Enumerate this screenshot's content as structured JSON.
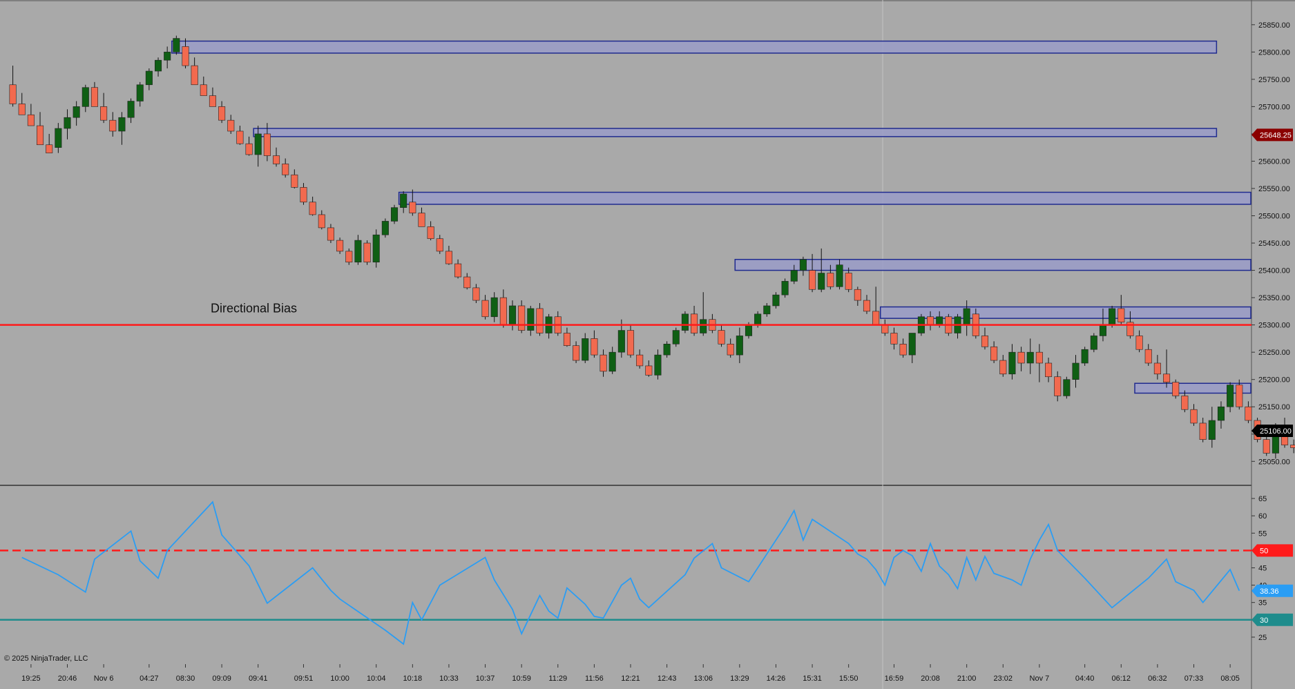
{
  "copyright": "© 2025 NinjaTrader, LLC",
  "colors": {
    "background": "#a9a9a9",
    "up_candle": "#0f5f14",
    "down_candle": "#f26a4f",
    "zone_fill": "#9a9cc8",
    "zone_stroke": "#1f2a8f",
    "bias_line": "#ff1a1a",
    "rsi_line": "#2a9df4",
    "rsi_30_line": "#1e8c8c",
    "rsi_50_line": "#ff1a1a",
    "last_price_tag": "#000000",
    "marker_price_tag": "#8b0000"
  },
  "chart_data": [
    {
      "type": "candlestick",
      "title": "",
      "annotation": "Directional Bias",
      "bias_level": 25300,
      "ylim": [
        25020,
        25870
      ],
      "y_ticks": [
        "25850.00",
        "25800.00",
        "25750.00",
        "25700.00",
        "25650.00",
        "25600.00",
        "25550.00",
        "25500.00",
        "25450.00",
        "25400.00",
        "25350.00",
        "25300.00",
        "25250.00",
        "25200.00",
        "25150.00",
        "25100.00",
        "25050.00"
      ],
      "y_tick_values": [
        25850,
        25800,
        25750,
        25700,
        25650,
        25600,
        25550,
        25500,
        25450,
        25400,
        25350,
        25300,
        25250,
        25200,
        25150,
        25100,
        25050
      ],
      "x_tick_labels": [
        "19:25",
        "20:46",
        "Nov 6",
        "04:27",
        "08:30",
        "09:09",
        "09:41",
        "09:51",
        "10:00",
        "10:04",
        "10:18",
        "10:33",
        "10:37",
        "10:59",
        "11:29",
        "11:56",
        "12:21",
        "12:43",
        "13:06",
        "13:29",
        "14:26",
        "15:31",
        "15:50",
        "16:59",
        "20:08",
        "21:00",
        "23:02",
        "Nov 7",
        "04:40",
        "06:12",
        "06:32",
        "07:33",
        "08:05"
      ],
      "x_tick_bar_index": [
        2,
        6,
        10,
        15,
        19,
        23,
        27,
        32,
        36,
        40,
        44,
        48,
        52,
        56,
        60,
        64,
        68,
        72,
        76,
        80,
        84,
        88,
        92,
        97,
        101,
        105,
        109,
        113,
        118,
        122,
        126,
        130,
        134
      ],
      "bar_count": 137,
      "marked_price": "25648.25",
      "last_price": "25106.00",
      "candles": [
        [
          25740,
          25775,
          25700,
          25705
        ],
        [
          25705,
          25725,
          25685,
          25685
        ],
        [
          25685,
          25705,
          25665,
          25665
        ],
        [
          25665,
          25690,
          25630,
          25630
        ],
        [
          25630,
          25650,
          25615,
          25615
        ],
        [
          25625,
          25670,
          25615,
          25660
        ],
        [
          25660,
          25695,
          25640,
          25680
        ],
        [
          25680,
          25710,
          25665,
          25700
        ],
        [
          25700,
          25740,
          25690,
          25735
        ],
        [
          25735,
          25745,
          25700,
          25700
        ],
        [
          25700,
          25725,
          25670,
          25675
        ],
        [
          25675,
          25690,
          25645,
          25655
        ],
        [
          25655,
          25690,
          25630,
          25680
        ],
        [
          25680,
          25715,
          25670,
          25710
        ],
        [
          25710,
          25745,
          25700,
          25740
        ],
        [
          25740,
          25770,
          25730,
          25765
        ],
        [
          25765,
          25790,
          25755,
          25785
        ],
        [
          25785,
          25810,
          25770,
          25800
        ],
        [
          25800,
          25830,
          25795,
          25825
        ],
        [
          25810,
          25825,
          25770,
          25775
        ],
        [
          25775,
          25790,
          25740,
          25740
        ],
        [
          25740,
          25755,
          25720,
          25720
        ],
        [
          25720,
          25735,
          25700,
          25700
        ],
        [
          25700,
          25710,
          25670,
          25675
        ],
        [
          25675,
          25685,
          25650,
          25655
        ],
        [
          25655,
          25665,
          25630,
          25632
        ],
        [
          25632,
          25645,
          25610,
          25612
        ],
        [
          25612,
          25665,
          25590,
          25650
        ],
        [
          25650,
          25670,
          25600,
          25610
        ],
        [
          25610,
          25625,
          25590,
          25595
        ],
        [
          25595,
          25605,
          25570,
          25575
        ],
        [
          25575,
          25585,
          25550,
          25552
        ],
        [
          25552,
          25560,
          25520,
          25525
        ],
        [
          25525,
          25535,
          25500,
          25502
        ],
        [
          25502,
          25510,
          25475,
          25478
        ],
        [
          25478,
          25485,
          25450,
          25455
        ],
        [
          25455,
          25460,
          25430,
          25435
        ],
        [
          25435,
          25440,
          25410,
          25415
        ],
        [
          25415,
          25465,
          25410,
          25455
        ],
        [
          25450,
          25455,
          25410,
          25415
        ],
        [
          25415,
          25475,
          25405,
          25465
        ],
        [
          25465,
          25495,
          25460,
          25490
        ],
        [
          25490,
          25520,
          25485,
          25515
        ],
        [
          25515,
          25545,
          25505,
          25540
        ],
        [
          25525,
          25548,
          25500,
          25505
        ],
        [
          25505,
          25515,
          25480,
          25480
        ],
        [
          25480,
          25490,
          25455,
          25458
        ],
        [
          25458,
          25465,
          25430,
          25435
        ],
        [
          25435,
          25445,
          25410,
          25412
        ],
        [
          25412,
          25420,
          25385,
          25388
        ],
        [
          25388,
          25395,
          25365,
          25368
        ],
        [
          25368,
          25375,
          25340,
          25345
        ],
        [
          25345,
          25355,
          25310,
          25315
        ],
        [
          25315,
          25360,
          25305,
          25350
        ],
        [
          25350,
          25365,
          25295,
          25300
        ],
        [
          25300,
          25345,
          25290,
          25335
        ],
        [
          25335,
          25345,
          25285,
          25290
        ],
        [
          25290,
          25335,
          25280,
          25330
        ],
        [
          25330,
          25340,
          25280,
          25285
        ],
        [
          25285,
          25320,
          25275,
          25315
        ],
        [
          25315,
          25325,
          25280,
          25285
        ],
        [
          25285,
          25295,
          25260,
          25262
        ],
        [
          25262,
          25270,
          25230,
          25235
        ],
        [
          25235,
          25285,
          25230,
          25275
        ],
        [
          25275,
          25290,
          25240,
          25245
        ],
        [
          25245,
          25255,
          25205,
          25215
        ],
        [
          25215,
          25260,
          25210,
          25250
        ],
        [
          25250,
          25310,
          25240,
          25290
        ],
        [
          25290,
          25300,
          25240,
          25245
        ],
        [
          25245,
          25255,
          25220,
          25225
        ],
        [
          25225,
          25235,
          25205,
          25208
        ],
        [
          25208,
          25255,
          25200,
          25245
        ],
        [
          25245,
          25270,
          25240,
          25265
        ],
        [
          25265,
          25295,
          25260,
          25290
        ],
        [
          25290,
          25325,
          25285,
          25320
        ],
        [
          25320,
          25335,
          25280,
          25285
        ],
        [
          25285,
          25360,
          25280,
          25310
        ],
        [
          25310,
          25320,
          25285,
          25290
        ],
        [
          25290,
          25300,
          25260,
          25265
        ],
        [
          25265,
          25275,
          25240,
          25245
        ],
        [
          25245,
          25295,
          25230,
          25280
        ],
        [
          25280,
          25305,
          25275,
          25300
        ],
        [
          25300,
          25325,
          25295,
          25320
        ],
        [
          25320,
          25340,
          25315,
          25335
        ],
        [
          25335,
          25360,
          25330,
          25355
        ],
        [
          25355,
          25385,
          25350,
          25380
        ],
        [
          25380,
          25410,
          25375,
          25400
        ],
        [
          25400,
          25425,
          25390,
          25420
        ],
        [
          25400,
          25430,
          25360,
          25365
        ],
        [
          25365,
          25440,
          25360,
          25395
        ],
        [
          25395,
          25410,
          25365,
          25370
        ],
        [
          25370,
          25420,
          25365,
          25410
        ],
        [
          25395,
          25405,
          25360,
          25365
        ],
        [
          25365,
          25370,
          25335,
          25345
        ],
        [
          25345,
          25355,
          25320,
          25325
        ],
        [
          25325,
          25370,
          25305,
          25300
        ],
        [
          25300,
          25310,
          25280,
          25285
        ],
        [
          25285,
          25295,
          25255,
          25265
        ],
        [
          25265,
          25275,
          25240,
          25245
        ],
        [
          25245,
          25270,
          25230,
          25285
        ],
        [
          25285,
          25320,
          25280,
          25315
        ],
        [
          25315,
          25325,
          25290,
          25300
        ],
        [
          25300,
          25325,
          25295,
          25315
        ],
        [
          25315,
          25320,
          25280,
          25285
        ],
        [
          25285,
          25320,
          25275,
          25315
        ],
        [
          25300,
          25345,
          25280,
          25330
        ],
        [
          25320,
          25330,
          25275,
          25280
        ],
        [
          25280,
          25295,
          25255,
          25260
        ],
        [
          25260,
          25270,
          25230,
          25235
        ],
        [
          25235,
          25245,
          25205,
          25210
        ],
        [
          25210,
          25265,
          25200,
          25250
        ],
        [
          25250,
          25260,
          25215,
          25230
        ],
        [
          25230,
          25275,
          25210,
          25250
        ],
        [
          25250,
          25265,
          25195,
          25230
        ],
        [
          25230,
          25240,
          25195,
          25205
        ],
        [
          25205,
          25215,
          25160,
          25170
        ],
        [
          25170,
          25205,
          25165,
          25200
        ],
        [
          25200,
          25245,
          25185,
          25230
        ],
        [
          25230,
          25260,
          25225,
          25255
        ],
        [
          25255,
          25285,
          25250,
          25280
        ],
        [
          25280,
          25330,
          25270,
          25300
        ],
        [
          25300,
          25335,
          25295,
          25330
        ],
        [
          25330,
          25355,
          25300,
          25305
        ],
        [
          25305,
          25325,
          25275,
          25280
        ],
        [
          25280,
          25290,
          25250,
          25255
        ],
        [
          25255,
          25265,
          25225,
          25230
        ],
        [
          25230,
          25245,
          25200,
          25210
        ],
        [
          25210,
          25255,
          25185,
          25195
        ],
        [
          25195,
          25200,
          25165,
          25170
        ],
        [
          25170,
          25180,
          25140,
          25145
        ],
        [
          25145,
          25155,
          25115,
          25120
        ],
        [
          25120,
          25130,
          25085,
          25090
        ],
        [
          25090,
          25150,
          25075,
          25125
        ],
        [
          25125,
          25160,
          25110,
          25150
        ],
        [
          25150,
          25195,
          25140,
          25190
        ],
        [
          25190,
          25200,
          25145,
          25150
        ],
        [
          25150,
          25160,
          25120,
          25125
        ],
        [
          25125,
          25130,
          25085,
          25090
        ],
        [
          25090,
          25100,
          25060,
          25065
        ],
        [
          25065,
          25120,
          25055,
          25110
        ],
        [
          25110,
          25130,
          25075,
          25080
        ],
        [
          25080,
          25090,
          25065,
          25075
        ],
        [
          25075,
          25110,
          25070,
          25106
        ]
      ],
      "supply_zones": [
        {
          "top": 25820,
          "bottom": 25798,
          "start_bar": 18,
          "end_bar": 133
        },
        {
          "top": 25660,
          "bottom": 25645,
          "start_bar": 27,
          "end_bar": 133
        },
        {
          "top": 25543,
          "bottom": 25521,
          "start_bar": 43,
          "end_bar": 137
        },
        {
          "top": 25420,
          "bottom": 25400,
          "start_bar": 80,
          "end_bar": 137
        },
        {
          "top": 25333,
          "bottom": 25312,
          "start_bar": 96,
          "end_bar": 137
        },
        {
          "top": 25193,
          "bottom": 25175,
          "start_bar": 124,
          "end_bar": 137
        }
      ]
    },
    {
      "type": "line",
      "title": "",
      "ylim": [
        20,
        67
      ],
      "y_ticks": [
        "65",
        "60",
        "55",
        "50",
        "45",
        "40",
        "35",
        "30",
        "25"
      ],
      "y_tick_values": [
        65,
        60,
        55,
        50,
        45,
        40,
        35,
        30,
        25
      ],
      "level_50": 50,
      "level_30": 30,
      "level_50_label": "50",
      "level_30_label": "30",
      "last_value": "38.36",
      "series": [
        {
          "x": [
            1,
            5,
            8,
            9,
            13,
            14,
            16,
            17,
            22,
            23,
            26,
            28,
            33,
            35,
            36,
            41,
            43,
            44,
            45,
            47,
            52,
            53,
            55,
            56,
            58,
            59,
            60,
            61,
            63,
            64,
            65,
            67,
            68,
            69,
            70,
            74,
            75,
            77,
            78,
            81,
            85,
            86,
            87,
            88,
            92,
            93,
            94,
            95,
            96,
            97,
            98,
            99,
            100,
            101,
            102,
            103,
            104,
            105,
            106,
            107,
            108,
            110,
            111,
            112,
            113,
            114,
            115,
            118,
            121,
            125,
            127,
            128,
            130,
            131,
            134,
            135
          ],
          "y": [
            48,
            43,
            38,
            47.5,
            55.6,
            47,
            42,
            50,
            64,
            54.5,
            45.6,
            34.8,
            45,
            38.5,
            36,
            27,
            23,
            35,
            30,
            40,
            48,
            41.5,
            33,
            26,
            37,
            32.5,
            30.5,
            39.2,
            34.5,
            31,
            30.5,
            40,
            42,
            36,
            33.5,
            43,
            47.8,
            52,
            45,
            41,
            57,
            61.5,
            53,
            59,
            52,
            49,
            47.5,
            44.5,
            40,
            48,
            50,
            48.5,
            44,
            52,
            45.5,
            43,
            39,
            48,
            41.5,
            48.3,
            43.4,
            41.5,
            40,
            47.5,
            53,
            57.5,
            50,
            42,
            33.5,
            42,
            47.5,
            41,
            38.5,
            35,
            44.5,
            38.4
          ]
        }
      ]
    }
  ]
}
